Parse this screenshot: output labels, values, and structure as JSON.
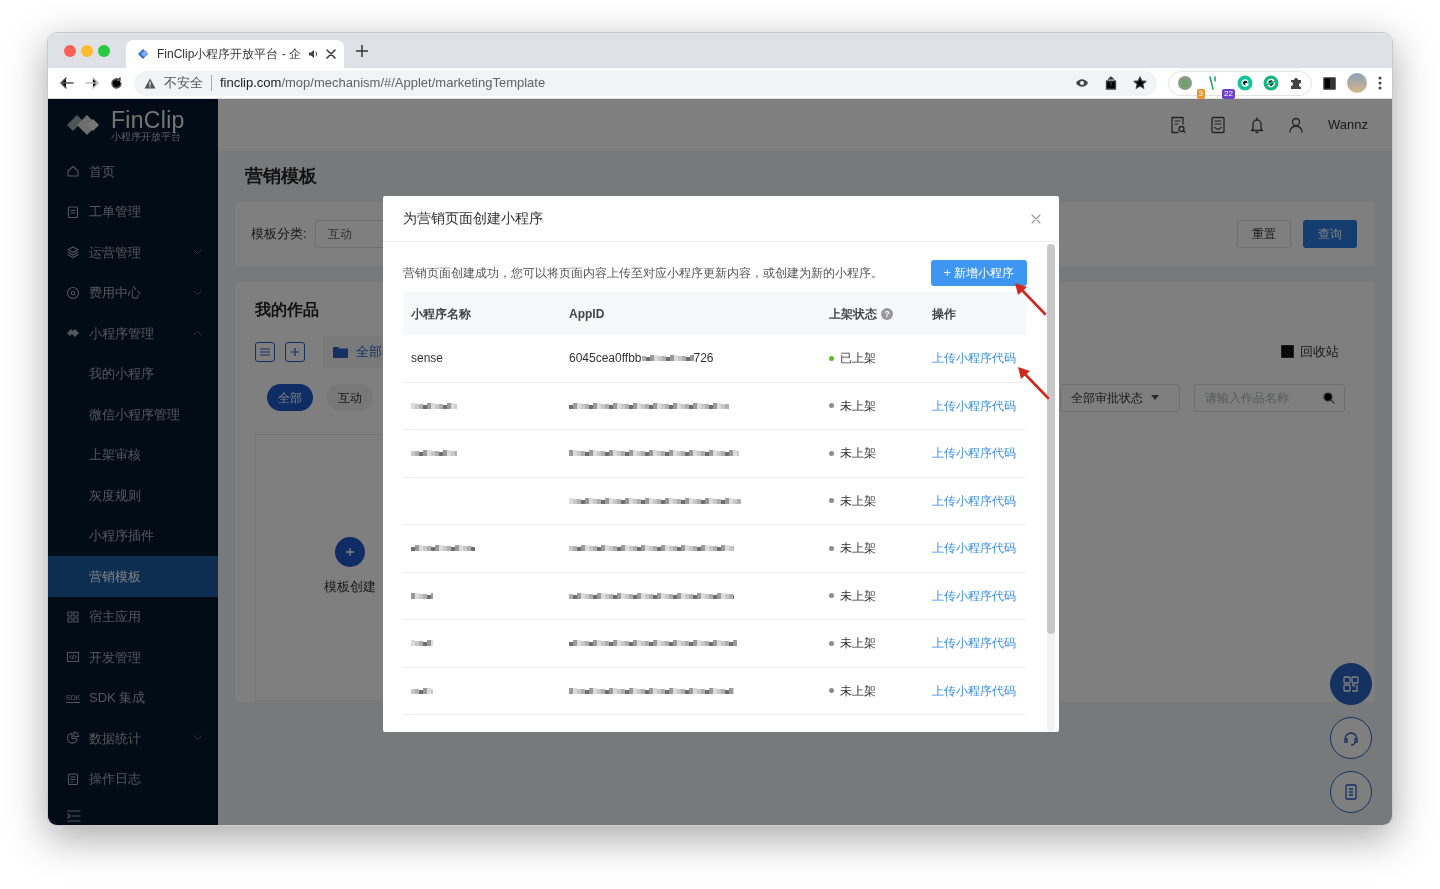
{
  "browser": {
    "tab_title": "FinClip小程序开放平台 - 企",
    "security_label": "不安全",
    "url_host": "finclip.com",
    "url_path": "/mop/mechanism/#/Applet/marketingTemplate",
    "extension_badges": [
      "3",
      "22"
    ]
  },
  "sidebar": {
    "logo_title": "FinClip",
    "logo_subtitle": "小程序开放平台",
    "items": [
      {
        "label": "首页",
        "selected": false
      },
      {
        "label": "工单管理",
        "selected": false
      },
      {
        "label": "运营管理",
        "selected": false,
        "expanded": false
      },
      {
        "label": "费用中心",
        "selected": false,
        "expanded": false
      },
      {
        "label": "小程序管理",
        "selected": false,
        "expanded": true,
        "children": [
          {
            "label": "我的小程序",
            "selected": false
          },
          {
            "label": "微信小程序管理",
            "selected": false
          },
          {
            "label": "上架审核",
            "selected": false
          },
          {
            "label": "灰度规则",
            "selected": false
          },
          {
            "label": "小程序插件",
            "selected": false
          },
          {
            "label": "营销模板",
            "selected": true
          }
        ]
      },
      {
        "label": "宿主应用",
        "selected": false
      },
      {
        "label": "开发管理",
        "selected": false
      },
      {
        "label": "SDK 集成",
        "selected": false,
        "icon_text": "SDK"
      },
      {
        "label": "数据统计",
        "selected": false,
        "expanded": false
      },
      {
        "label": "操作日志",
        "selected": false
      }
    ]
  },
  "header": {
    "user": "Wannz"
  },
  "page": {
    "title": "营销模板",
    "filter": {
      "label": "模板分类:",
      "value": "互动",
      "buttons": [
        "重置",
        "查询"
      ]
    },
    "works": {
      "title": "我的作品",
      "folder_tab": "全部",
      "recycle": "回收站",
      "chips": [
        {
          "label": "全部",
          "selected": true
        },
        {
          "label": "互动",
          "selected": false
        }
      ],
      "status_select": "全部审批状态",
      "search_placeholder": "请输入作品名称",
      "create_label": "模板创建"
    }
  },
  "float_buttons": [
    {
      "filled": true
    },
    {
      "filled": false
    },
    {
      "filled": false
    }
  ],
  "modal": {
    "title": "为营销页面创建小程序",
    "description": "营销页面创建成功，您可以将页面内容上传至对应小程序更新内容，或创建为新的小程序。",
    "add_button": "+ 新增小程序",
    "columns": [
      {
        "label": "小程序名称"
      },
      {
        "label": "AppID"
      },
      {
        "label": "上架状态",
        "help": "?"
      },
      {
        "label": "操作"
      }
    ],
    "rows": [
      {
        "name": "sense",
        "name_redacted": false,
        "appid_start": "6045cea0ffbb",
        "appid_end": "726",
        "appid_redacted": true,
        "status": "已上架",
        "published": true,
        "action": "上传小程序代码"
      },
      {
        "name_redacted": true,
        "appid_redacted": true,
        "status": "未上架",
        "published": false,
        "action": "上传小程序代码"
      },
      {
        "name_redacted": true,
        "appid_redacted": true,
        "status": "未上架",
        "published": false,
        "action": "上传小程序代码"
      },
      {
        "name_redacted": false,
        "appid_redacted": true,
        "status": "未上架",
        "published": false,
        "action": "上传小程序代码"
      },
      {
        "name_redacted": true,
        "appid_redacted": true,
        "status": "未上架",
        "published": false,
        "action": "上传小程序代码"
      },
      {
        "name_redacted": true,
        "appid_redacted": true,
        "status": "未上架",
        "published": false,
        "action": "上传小程序代码"
      },
      {
        "name_redacted": true,
        "appid_redacted": true,
        "status": "未上架",
        "published": false,
        "action": "上传小程序代码"
      },
      {
        "name_redacted": true,
        "appid_redacted": true,
        "status": "未上架",
        "published": false,
        "action": "上传小程序代码"
      }
    ]
  }
}
